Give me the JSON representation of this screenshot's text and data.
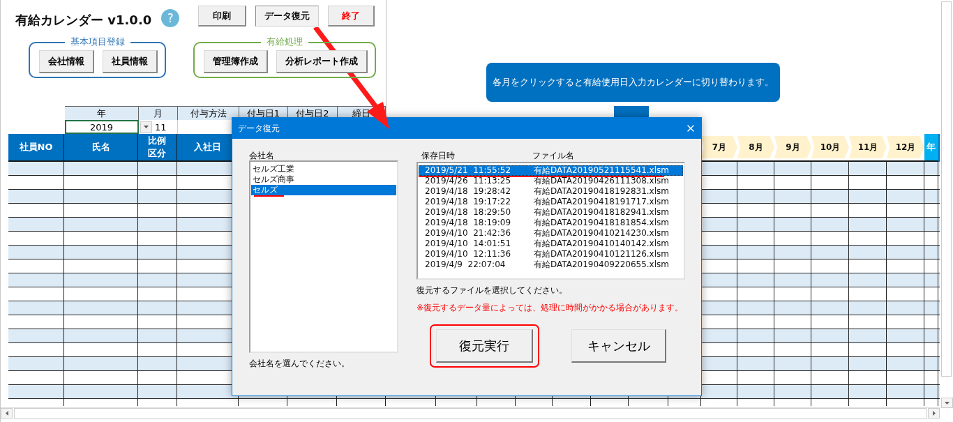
{
  "app": {
    "title": "有給カレンダー v1.0.0",
    "help_label": "?"
  },
  "toolbar": [
    {
      "label": "印刷",
      "kind": "normal"
    },
    {
      "label": "データ復元",
      "kind": "active"
    },
    {
      "label": "終了",
      "kind": "exit"
    }
  ],
  "groups": [
    {
      "title": "基本項目登録",
      "color": "#2e75b6",
      "buttons": [
        "会社情報",
        "社員情報"
      ]
    },
    {
      "title": "有給処理",
      "color": "#70ad47",
      "buttons": [
        "管理簿作成",
        "分析レポート作成"
      ]
    }
  ],
  "banner": {
    "text": "各月をクリックすると有給使用日入力カレンダーに切り替わります。"
  },
  "settings": {
    "columns": [
      "年",
      "月",
      "付与方法",
      "付与日1",
      "付与日2",
      "締日"
    ],
    "values": [
      "2019",
      "11"
    ]
  },
  "table": {
    "columns": [
      "社員NO",
      "氏名",
      "比例区分",
      "入社日"
    ],
    "months": [
      "7月",
      "8月",
      "9月",
      "10月",
      "11月",
      "12月"
    ],
    "last_column": "年"
  },
  "dialog": {
    "title": "データ復元",
    "company_label": "会社名",
    "companies": [
      {
        "name": "セルズ工業",
        "selected": false
      },
      {
        "name": "セルズ商事",
        "selected": false
      },
      {
        "name": "セルズ",
        "selected": true
      }
    ],
    "company_hint": "会社名を選んでください。",
    "file_columns": [
      "保存日時",
      "ファイル名"
    ],
    "files": [
      {
        "saved": "2019/5/21  11:55:52",
        "file": "有給DATA20190521115541.xlsm",
        "selected": true
      },
      {
        "saved": "2019/4/26  11:13:25",
        "file": "有給DATA20190426111308.xlsm",
        "selected": false
      },
      {
        "saved": "2019/4/18  19:28:42",
        "file": "有給DATA20190418192831.xlsm",
        "selected": false
      },
      {
        "saved": "2019/4/18  19:17:22",
        "file": "有給DATA20190418191717.xlsm",
        "selected": false
      },
      {
        "saved": "2019/4/18  18:29:50",
        "file": "有給DATA20190418182941.xlsm",
        "selected": false
      },
      {
        "saved": "2019/4/18  18:19:09",
        "file": "有給DATA20190418181854.xlsm",
        "selected": false
      },
      {
        "saved": "2019/4/10  21:42:36",
        "file": "有給DATA20190410214230.xlsm",
        "selected": false
      },
      {
        "saved": "2019/4/10  14:01:51",
        "file": "有給DATA20190410140142.xlsm",
        "selected": false
      },
      {
        "saved": "2019/4/10  12:11:36",
        "file": "有給DATA20190410121126.xlsm",
        "selected": false
      },
      {
        "saved": "2019/4/9  22:07:04",
        "file": "有給DATA20190409220655.xlsm",
        "selected": false
      }
    ],
    "file_hint": "復元するファイルを選択してください。",
    "warning": "※復元するデータ量によっては、処理に時間がかかる場合があります。",
    "buttons": [
      {
        "label": "復元実行",
        "kind": "primary"
      },
      {
        "label": "キャンセル",
        "kind": "cancel"
      }
    ]
  }
}
